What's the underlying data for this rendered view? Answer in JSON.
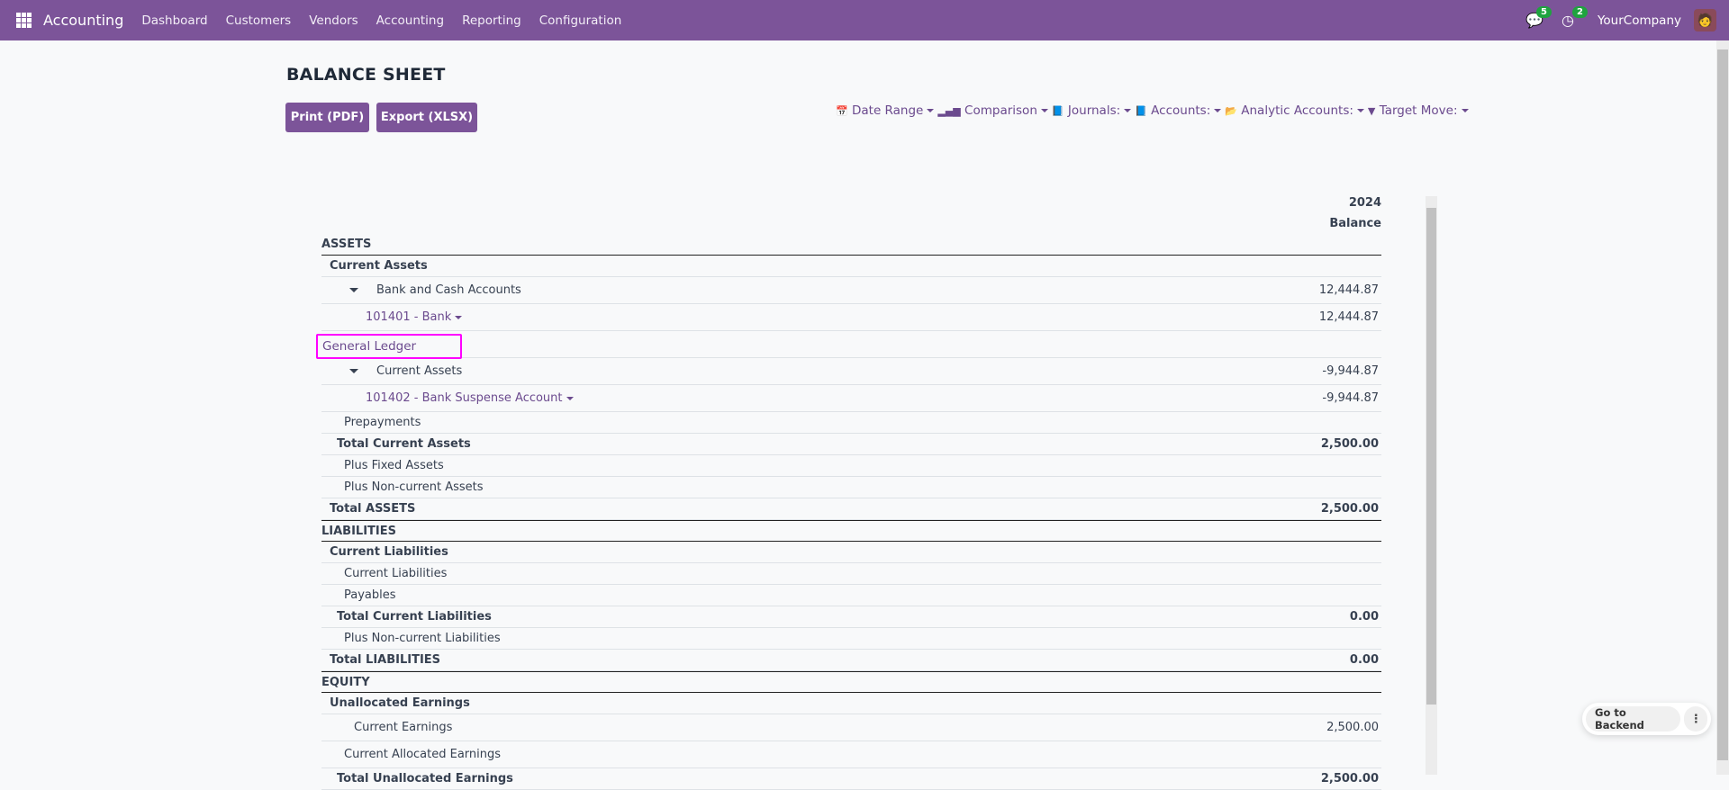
{
  "navbar": {
    "app": "Accounting",
    "menus": [
      "Dashboard",
      "Customers",
      "Vendors",
      "Accounting",
      "Reporting",
      "Configuration"
    ],
    "messages_count": "5",
    "activities_count": "2",
    "company": "YourCompany",
    "color": "#7c5499"
  },
  "page": {
    "title": "BALANCE SHEET",
    "print_label": "Print (PDF)",
    "export_label": "Export (XLSX)"
  },
  "filters": [
    {
      "icon": "calendar-icon",
      "label": "Date Range"
    },
    {
      "icon": "bar-chart-icon",
      "label": "Comparison"
    },
    {
      "icon": "book-icon",
      "label": "Journals:"
    },
    {
      "icon": "book-icon",
      "label": "Accounts:"
    },
    {
      "icon": "folder-open-icon",
      "label": "Analytic Accounts:"
    },
    {
      "icon": "filter-icon",
      "label": "Target Move:"
    }
  ],
  "report": {
    "column_year": "2024",
    "column_label": "Balance",
    "rows": [
      {
        "label": "ASSETS",
        "kind": "section",
        "amount": ""
      },
      {
        "label": "Current Assets",
        "kind": "group",
        "amount": ""
      },
      {
        "label": "Bank and Cash Accounts",
        "kind": "expandable",
        "amount": "12,444.87"
      },
      {
        "label": "101401 - Bank",
        "kind": "account",
        "amount": "12,444.87"
      },
      {
        "label": "",
        "kind": "blank",
        "amount": ""
      },
      {
        "label": "Current Assets",
        "kind": "expandable",
        "amount": "-9,944.87"
      },
      {
        "label": "101402 - Bank Suspense Account",
        "kind": "account",
        "amount": "-9,944.87"
      },
      {
        "label": "Prepayments",
        "kind": "line",
        "amount": ""
      },
      {
        "label": "Total Current Assets",
        "kind": "total",
        "amount": "2,500.00"
      },
      {
        "label": "Plus Fixed Assets",
        "kind": "line",
        "amount": ""
      },
      {
        "label": "Plus Non-current Assets",
        "kind": "line",
        "amount": ""
      },
      {
        "label": "Total ASSETS",
        "kind": "group",
        "amount": "2,500.00"
      },
      {
        "label": "LIABILITIES",
        "kind": "section",
        "amount": ""
      },
      {
        "label": "Current Liabilities",
        "kind": "group",
        "amount": ""
      },
      {
        "label": "Current Liabilities",
        "kind": "line",
        "amount": ""
      },
      {
        "label": "Payables",
        "kind": "line",
        "amount": ""
      },
      {
        "label": "Total Current Liabilities",
        "kind": "total",
        "amount": "0.00"
      },
      {
        "label": "Plus Non-current Liabilities",
        "kind": "line",
        "amount": ""
      },
      {
        "label": "Total LIABILITIES",
        "kind": "group",
        "amount": "0.00"
      },
      {
        "label": "EQUITY",
        "kind": "section",
        "amount": ""
      },
      {
        "label": "Unallocated Earnings",
        "kind": "group",
        "amount": ""
      },
      {
        "label": "Current Earnings",
        "kind": "deep",
        "amount": "2,500.00"
      },
      {
        "label": "Current Allocated Earnings",
        "kind": "line",
        "amount": ""
      },
      {
        "label": "Total Unallocated Earnings",
        "kind": "total",
        "amount": "2,500.00"
      }
    ]
  },
  "account_menu": {
    "item": "General Ledger",
    "highlight_color": "#ff00ff"
  },
  "floating": {
    "backend_label": "Go to Backend",
    "more_icon": "kebab-icon"
  }
}
